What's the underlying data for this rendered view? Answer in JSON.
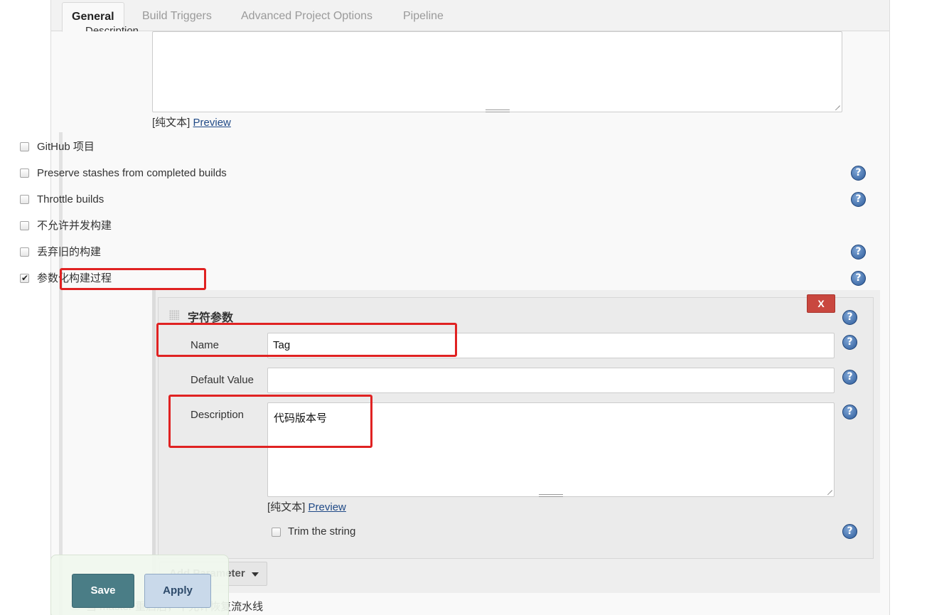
{
  "tabs": [
    {
      "label": "General",
      "active": true
    },
    {
      "label": "Build Triggers"
    },
    {
      "label": "Advanced Project Options"
    },
    {
      "label": "Pipeline"
    }
  ],
  "description_section": {
    "label": "Description",
    "value": "",
    "format": {
      "plain_text": "[纯文本]",
      "preview": "Preview"
    }
  },
  "options": [
    {
      "label": "GitHub 项目",
      "checked": false,
      "help": false
    },
    {
      "label": "Preserve stashes from completed builds",
      "checked": false,
      "help": true
    },
    {
      "label": "Throttle builds",
      "checked": false,
      "help": true
    },
    {
      "label": "不允许并发构建",
      "checked": false,
      "help": false
    },
    {
      "label": "丢弃旧的构建",
      "checked": false,
      "help": true
    },
    {
      "label": "参数化构建过程",
      "checked": true,
      "help": true
    }
  ],
  "parameter": {
    "title": "字符参数",
    "delete_label": "X",
    "name_label": "Name",
    "name_value": "Tag",
    "default_label": "Default Value",
    "default_value": "",
    "description_label": "Description",
    "description_value": "代码版本号",
    "format": {
      "plain_text": "[纯文本]",
      "preview": "Preview"
    },
    "trim_label": "Trim the string",
    "trim_checked": false
  },
  "add_parameter_label": "Add Parameter",
  "bottom_option": "当 master 重启后，不允许恢复流水线",
  "buttons": {
    "save": "Save",
    "apply": "Apply"
  },
  "help_glyph": "?",
  "colors": {
    "highlight": "#e02222",
    "save": "#4a7d86",
    "apply": "#c9d9ea",
    "delete": "#c9473f",
    "link": "#204a87"
  }
}
